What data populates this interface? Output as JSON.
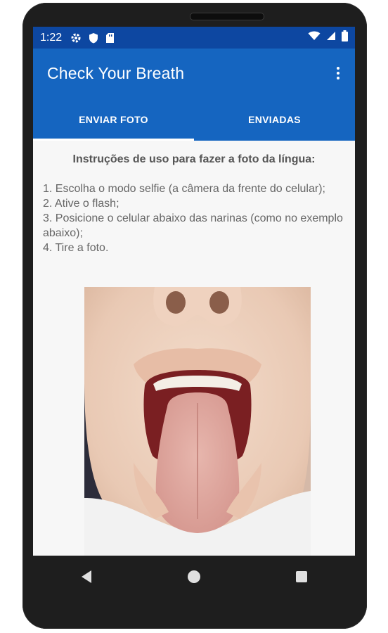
{
  "status": {
    "time": "1:22",
    "left_icons": [
      "gear-icon",
      "shield-icon",
      "sd-card-icon"
    ],
    "right_icons": [
      "wifi-icon",
      "signal-icon",
      "battery-icon"
    ]
  },
  "appbar": {
    "title": "Check Your Breath",
    "menu_icon": "more-vert-icon"
  },
  "tabs": [
    {
      "label": "ENVIAR FOTO",
      "active": true
    },
    {
      "label": "ENVIADAS",
      "active": false
    }
  ],
  "instructions": {
    "heading": "Instruções de uso para fazer a foto da língua:",
    "steps": [
      " 1. Escolha o modo selfie (a câmera da frente do celular);",
      " 2. Ative o flash;",
      " 3. Posicione o celular abaixo das narinas (como no exemplo abaixo);",
      " 4. Tire a foto."
    ]
  },
  "example_photo": {
    "subject": "tongue-example-photo"
  },
  "navbar": {
    "icons": [
      "back-icon",
      "home-icon",
      "recents-icon"
    ]
  },
  "colors": {
    "status_bar": "#0d47a1",
    "app_bar": "#1565c0",
    "background": "#f7f7f7",
    "text": "#666666"
  }
}
